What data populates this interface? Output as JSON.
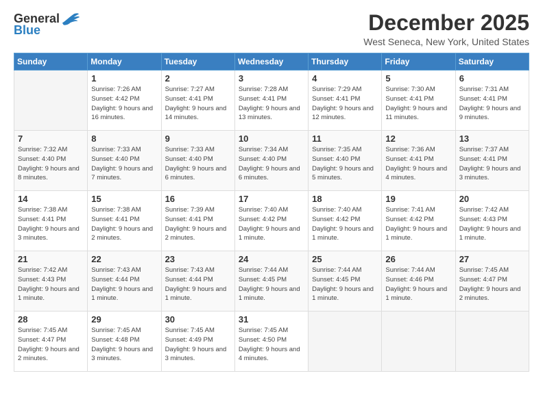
{
  "logo": {
    "general": "General",
    "blue": "Blue"
  },
  "title": "December 2025",
  "subtitle": "West Seneca, New York, United States",
  "days_of_week": [
    "Sunday",
    "Monday",
    "Tuesday",
    "Wednesday",
    "Thursday",
    "Friday",
    "Saturday"
  ],
  "weeks": [
    [
      {
        "day": "",
        "empty": true
      },
      {
        "day": "1",
        "sunrise": "7:26 AM",
        "sunset": "4:42 PM",
        "daylight": "9 hours and 16 minutes."
      },
      {
        "day": "2",
        "sunrise": "7:27 AM",
        "sunset": "4:41 PM",
        "daylight": "9 hours and 14 minutes."
      },
      {
        "day": "3",
        "sunrise": "7:28 AM",
        "sunset": "4:41 PM",
        "daylight": "9 hours and 13 minutes."
      },
      {
        "day": "4",
        "sunrise": "7:29 AM",
        "sunset": "4:41 PM",
        "daylight": "9 hours and 12 minutes."
      },
      {
        "day": "5",
        "sunrise": "7:30 AM",
        "sunset": "4:41 PM",
        "daylight": "9 hours and 11 minutes."
      },
      {
        "day": "6",
        "sunrise": "7:31 AM",
        "sunset": "4:41 PM",
        "daylight": "9 hours and 9 minutes."
      }
    ],
    [
      {
        "day": "7",
        "sunrise": "7:32 AM",
        "sunset": "4:40 PM",
        "daylight": "9 hours and 8 minutes."
      },
      {
        "day": "8",
        "sunrise": "7:33 AM",
        "sunset": "4:40 PM",
        "daylight": "9 hours and 7 minutes."
      },
      {
        "day": "9",
        "sunrise": "7:33 AM",
        "sunset": "4:40 PM",
        "daylight": "9 hours and 6 minutes."
      },
      {
        "day": "10",
        "sunrise": "7:34 AM",
        "sunset": "4:40 PM",
        "daylight": "9 hours and 6 minutes."
      },
      {
        "day": "11",
        "sunrise": "7:35 AM",
        "sunset": "4:40 PM",
        "daylight": "9 hours and 5 minutes."
      },
      {
        "day": "12",
        "sunrise": "7:36 AM",
        "sunset": "4:41 PM",
        "daylight": "9 hours and 4 minutes."
      },
      {
        "day": "13",
        "sunrise": "7:37 AM",
        "sunset": "4:41 PM",
        "daylight": "9 hours and 3 minutes."
      }
    ],
    [
      {
        "day": "14",
        "sunrise": "7:38 AM",
        "sunset": "4:41 PM",
        "daylight": "9 hours and 3 minutes."
      },
      {
        "day": "15",
        "sunrise": "7:38 AM",
        "sunset": "4:41 PM",
        "daylight": "9 hours and 2 minutes."
      },
      {
        "day": "16",
        "sunrise": "7:39 AM",
        "sunset": "4:41 PM",
        "daylight": "9 hours and 2 minutes."
      },
      {
        "day": "17",
        "sunrise": "7:40 AM",
        "sunset": "4:42 PM",
        "daylight": "9 hours and 1 minute."
      },
      {
        "day": "18",
        "sunrise": "7:40 AM",
        "sunset": "4:42 PM",
        "daylight": "9 hours and 1 minute."
      },
      {
        "day": "19",
        "sunrise": "7:41 AM",
        "sunset": "4:42 PM",
        "daylight": "9 hours and 1 minute."
      },
      {
        "day": "20",
        "sunrise": "7:42 AM",
        "sunset": "4:43 PM",
        "daylight": "9 hours and 1 minute."
      }
    ],
    [
      {
        "day": "21",
        "sunrise": "7:42 AM",
        "sunset": "4:43 PM",
        "daylight": "9 hours and 1 minute."
      },
      {
        "day": "22",
        "sunrise": "7:43 AM",
        "sunset": "4:44 PM",
        "daylight": "9 hours and 1 minute."
      },
      {
        "day": "23",
        "sunrise": "7:43 AM",
        "sunset": "4:44 PM",
        "daylight": "9 hours and 1 minute."
      },
      {
        "day": "24",
        "sunrise": "7:44 AM",
        "sunset": "4:45 PM",
        "daylight": "9 hours and 1 minute."
      },
      {
        "day": "25",
        "sunrise": "7:44 AM",
        "sunset": "4:45 PM",
        "daylight": "9 hours and 1 minute."
      },
      {
        "day": "26",
        "sunrise": "7:44 AM",
        "sunset": "4:46 PM",
        "daylight": "9 hours and 1 minute."
      },
      {
        "day": "27",
        "sunrise": "7:45 AM",
        "sunset": "4:47 PM",
        "daylight": "9 hours and 2 minutes."
      }
    ],
    [
      {
        "day": "28",
        "sunrise": "7:45 AM",
        "sunset": "4:47 PM",
        "daylight": "9 hours and 2 minutes."
      },
      {
        "day": "29",
        "sunrise": "7:45 AM",
        "sunset": "4:48 PM",
        "daylight": "9 hours and 3 minutes."
      },
      {
        "day": "30",
        "sunrise": "7:45 AM",
        "sunset": "4:49 PM",
        "daylight": "9 hours and 3 minutes."
      },
      {
        "day": "31",
        "sunrise": "7:45 AM",
        "sunset": "4:50 PM",
        "daylight": "9 hours and 4 minutes."
      },
      {
        "day": "",
        "empty": true
      },
      {
        "day": "",
        "empty": true
      },
      {
        "day": "",
        "empty": true
      }
    ]
  ],
  "labels": {
    "sunrise": "Sunrise:",
    "sunset": "Sunset:",
    "daylight": "Daylight:"
  }
}
